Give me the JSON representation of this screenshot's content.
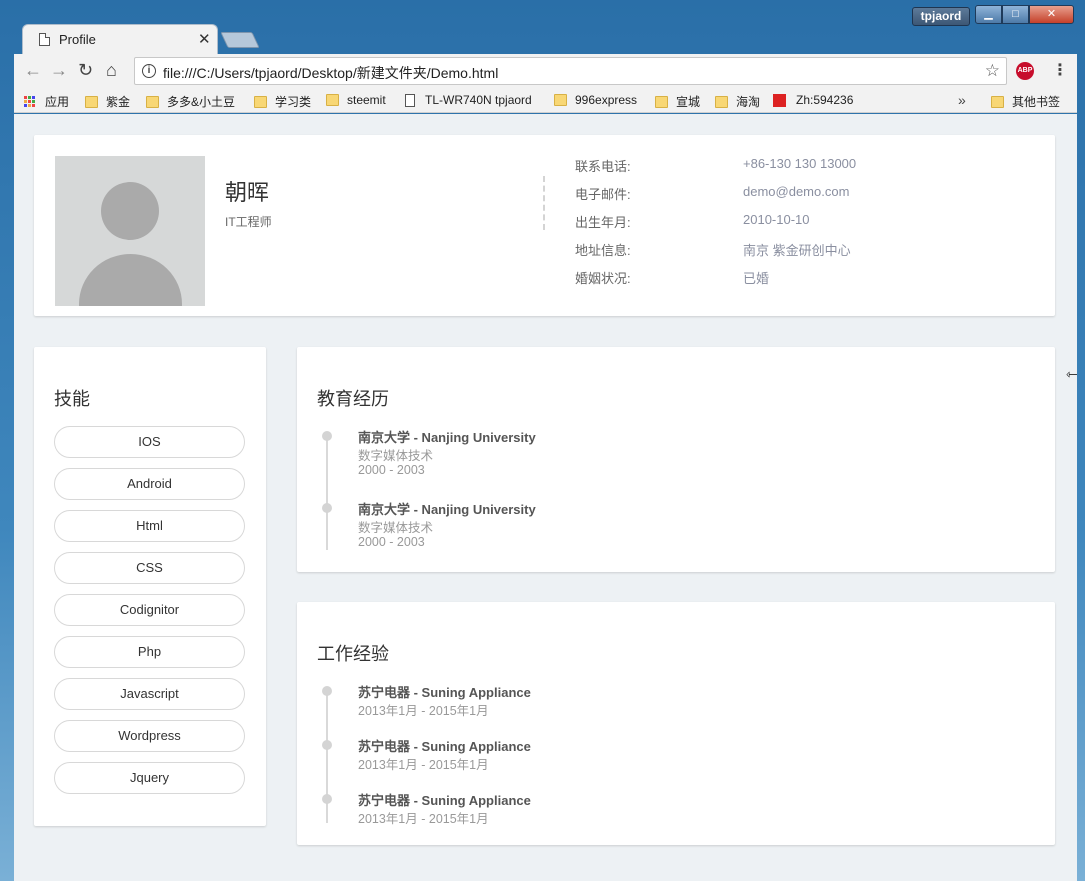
{
  "window": {
    "user_badge": "tpjaord",
    "min_glyph": "▁",
    "max_glyph": "□",
    "close_glyph": "✕"
  },
  "tab": {
    "title": "Profile",
    "close_glyph": "✕"
  },
  "toolbar": {
    "back_glyph": "←",
    "forward_glyph": "→",
    "reload_glyph": "↻",
    "home_glyph": "⌂",
    "info_glyph": "i",
    "url": "file:///C:/Users/tpjaord/Desktop/新建文件夹/Demo.html",
    "star_glyph": "☆",
    "abp_label": "ABP",
    "menu_glyph": "⋮"
  },
  "bookmarks": {
    "items": [
      "应用",
      "紫金",
      "多多&小土豆",
      "学习类",
      "steemit",
      "TL-WR740N tpjaord",
      "996express",
      "宣城",
      "海淘",
      "Zh:594236"
    ],
    "overflow_glyph": "»",
    "other": "其他书签"
  },
  "profile": {
    "name": "朝晖",
    "title": "IT工程师",
    "info": [
      {
        "label": "联系电话:",
        "value": "+86-130 130 13000"
      },
      {
        "label": "电子邮件:",
        "value": "demo@demo.com"
      },
      {
        "label": "出生年月:",
        "value": "2010-10-10"
      },
      {
        "label": "地址信息:",
        "value": "南京 紫金研创中心"
      },
      {
        "label": "婚姻状况:",
        "value": "已婚"
      }
    ]
  },
  "skills": {
    "heading": "技能",
    "items": [
      "IOS",
      "Android",
      "Html",
      "CSS",
      "Codignitor",
      "Php",
      "Javascript",
      "Wordpress",
      "Jquery"
    ]
  },
  "education": {
    "heading": "教育经历",
    "items": [
      {
        "title": "南京大学 - Nanjing University",
        "major": "数字媒体技术",
        "period": "2000 - 2003"
      },
      {
        "title": "南京大学 - Nanjing University",
        "major": "数字媒体技术",
        "period": "2000 - 2003"
      }
    ]
  },
  "work": {
    "heading": "工作经验",
    "items": [
      {
        "title": "苏宁电器 - Suning Appliance",
        "period": "2013年1月 - 2015年1月"
      },
      {
        "title": "苏宁电器 - Suning Appliance",
        "period": "2013年1月 - 2015年1月"
      },
      {
        "title": "苏宁电器 - Suning Appliance",
        "period": "2013年1月 - 2015年1月"
      }
    ]
  },
  "colors": {
    "page_bg": "#edf1f4",
    "card_bg": "#ffffff",
    "value_text": "#8a8fa0",
    "timeline": "#d9d9d9"
  }
}
